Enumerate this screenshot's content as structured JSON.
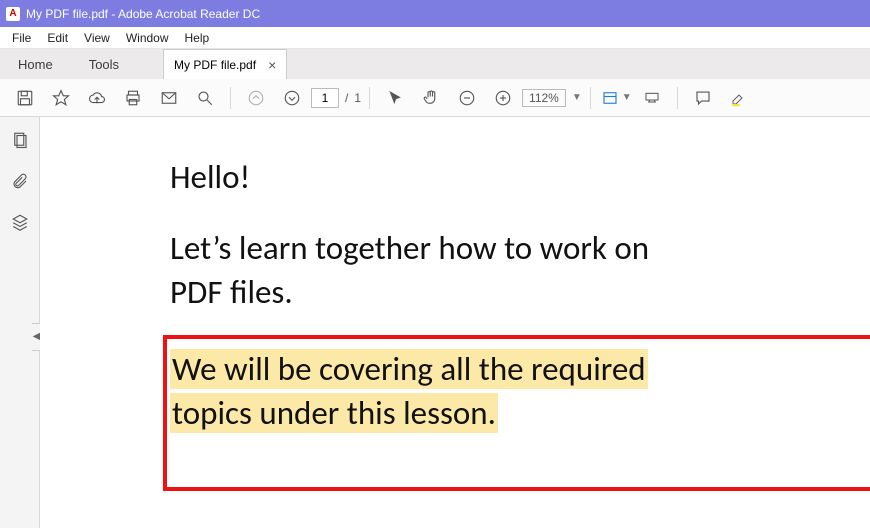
{
  "title": "My PDF file.pdf - Adobe Acrobat Reader DC",
  "menubar": {
    "file": "File",
    "edit": "Edit",
    "view": "View",
    "window": "Window",
    "help": "Help"
  },
  "tabs": {
    "home": "Home",
    "tools": "Tools",
    "filename": "My PDF file.pdf"
  },
  "toolbar": {
    "page_current": "1",
    "page_sep": "/",
    "page_total": "1",
    "zoom_value": "112%"
  },
  "document": {
    "p1": "Hello!",
    "p2_a": "Let’s learn together how to work on",
    "p2_b": "PDF files.",
    "p3_a": "We will be covering all the required",
    "p3_b": "topics under this lesson."
  }
}
